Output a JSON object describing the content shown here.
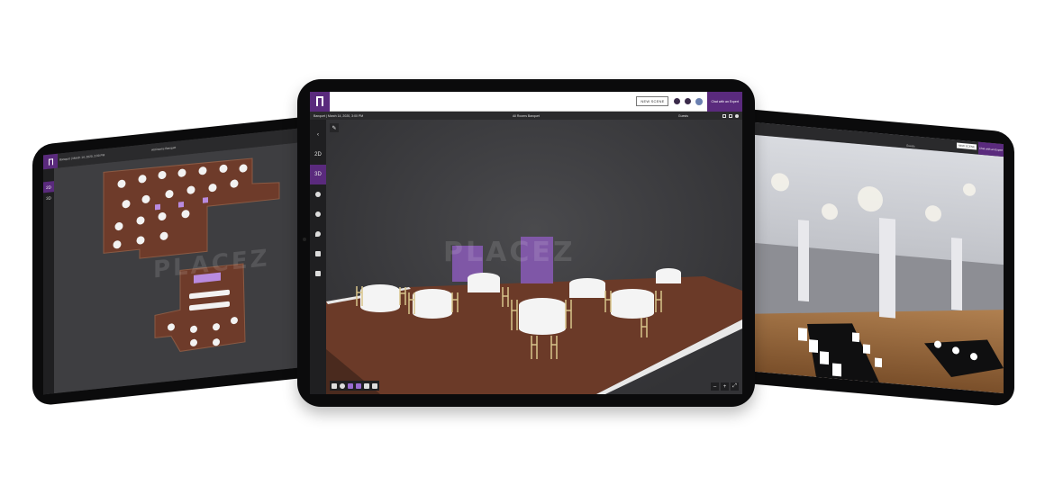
{
  "center": {
    "new_scene_label": "NEW SCENE",
    "help_icon": "question-icon",
    "settings_icon": "gear-icon",
    "chat_label": "Chat with an Expert",
    "event_info": "Banquet | March 14, 2020, 3:00 PM",
    "room_name": "All Rooms Banquet",
    "guests_label": "Guests",
    "sidebar": [
      {
        "label": "‹",
        "name": "back-button",
        "active": false
      },
      {
        "label": "2D",
        "name": "view-2d-button",
        "active": false
      },
      {
        "label": "3D",
        "name": "view-3d-button",
        "active": true
      }
    ],
    "watermark": "PLACEZ",
    "zoom_out": "–",
    "zoom_in": "+"
  },
  "left": {
    "room_name": "All Rooms Banquet",
    "event_info": "Banquet | March 14, 2020, 3:00 PM",
    "sidebar": [
      {
        "label": "2D",
        "active": true
      },
      {
        "label": "3D",
        "active": false
      }
    ],
    "watermark": "PLACEZ"
  },
  "right": {
    "new_scene_label": "NEW SCENE",
    "chat_label": "Chat with an Expert",
    "guests_label": "Guests"
  },
  "colors": {
    "brand_purple": "#5a2a7d",
    "floor_wood": "#6b3a2a",
    "dark_ui": "#1f1f21"
  }
}
